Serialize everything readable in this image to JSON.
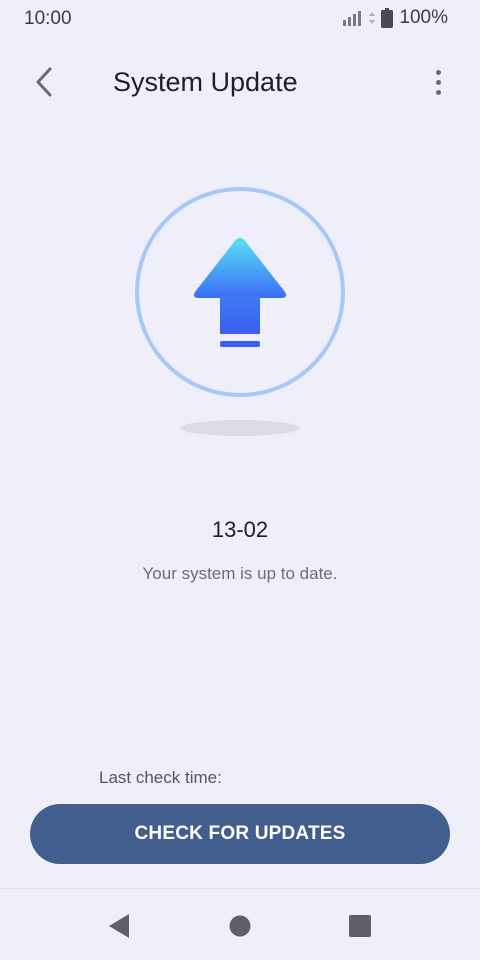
{
  "status_bar": {
    "time": "10:00",
    "battery": "100%",
    "signal_icon": "signal-icon",
    "battery_icon": "battery-icon"
  },
  "header": {
    "title": "System Update",
    "back_icon": "chevron-left-icon",
    "menu_icon": "more-vert-icon"
  },
  "main": {
    "illustration_icon": "upload-arrow-icon",
    "version": "13-02",
    "message": "Your system is up to date.",
    "last_check_label": "Last check time:",
    "check_button_label": "CHECK FOR UPDATES"
  },
  "nav_bar": {
    "back_icon": "nav-back-icon",
    "home_icon": "nav-home-icon",
    "recents_icon": "nav-recents-icon"
  },
  "colors": {
    "background": "#efeff9",
    "accent_button": "#425e8f",
    "ring": "#a8c8f5",
    "arrow_top": "#5ae0f7",
    "arrow_bottom": "#3a5ef2"
  }
}
